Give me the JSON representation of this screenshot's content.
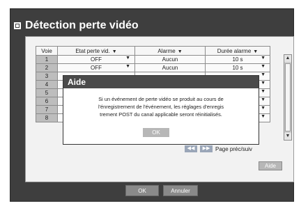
{
  "title": "Détection perte vidéo",
  "table": {
    "headers": [
      "Voie",
      "Etat perte vid.",
      "Alarme",
      "Durée alarme"
    ],
    "rows": [
      {
        "voie": "1",
        "etat": "OFF",
        "alarme": "Aucun",
        "duree": "10 s"
      },
      {
        "voie": "2",
        "etat": "OFF",
        "alarme": "Aucun",
        "duree": "10 s"
      },
      {
        "voie": "3",
        "etat": "",
        "alarme": "",
        "duree": ""
      },
      {
        "voie": "4",
        "etat": "",
        "alarme": "",
        "duree": ""
      },
      {
        "voie": "5",
        "etat": "",
        "alarme": "",
        "duree": ""
      },
      {
        "voie": "6",
        "etat": "",
        "alarme": "",
        "duree": ""
      },
      {
        "voie": "7",
        "etat": "",
        "alarme": "",
        "duree": ""
      },
      {
        "voie": "8",
        "etat": "",
        "alarme": "",
        "duree": ""
      }
    ]
  },
  "pager_label": "Page préc/suiv",
  "aide_button": "Aide",
  "dialog": {
    "title": "Aide",
    "message_lines": [
      "Si un événement de perte vidéo se produit au cours de",
      "l'énregistrement de l'événement, les réglages d'enregis",
      "trement POST du canal applicable seront réinitialisés."
    ],
    "ok": "OK"
  },
  "footer": {
    "ok": "OK",
    "cancel": "Annuler"
  },
  "icons": {
    "title": "square-icon",
    "dropdown": "triangle-down-icon",
    "pager_prev": "double-left-icon",
    "pager_next": "double-right-icon"
  }
}
